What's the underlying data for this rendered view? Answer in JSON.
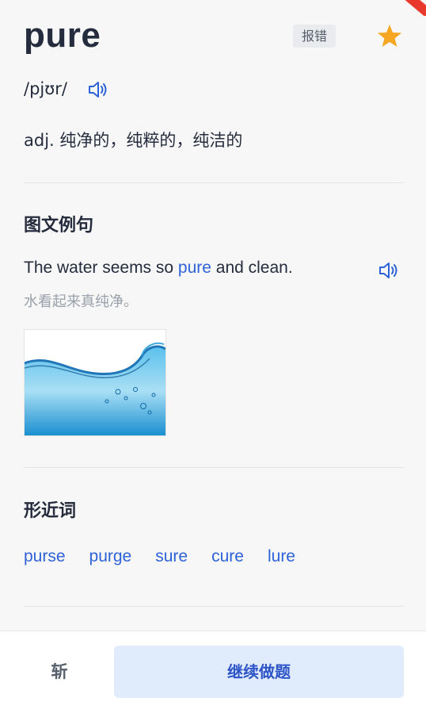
{
  "word": "pure",
  "report_label": "报错",
  "phonetic": "/pjʊr/",
  "definition": "adj. 纯净的，纯粹的，纯洁的",
  "example_section": {
    "title": "图文例句",
    "sentence_before": "The water seems so ",
    "sentence_highlight": "pure",
    "sentence_after": " and clean.",
    "translation": "水看起来真纯净。"
  },
  "similar_section": {
    "title": "形近词",
    "words": [
      "purse",
      "purge",
      "sure",
      "cure",
      "lure"
    ]
  },
  "footer": {
    "chop_label": "斩",
    "continue_label": "继续做题"
  },
  "colors": {
    "accent": "#2e62d8",
    "star": "#f5a623",
    "button_bg": "#e0ecfc",
    "ribbon": "#e8392c"
  },
  "icons": [
    "star-icon",
    "speaker-icon",
    "speaker-icon"
  ]
}
